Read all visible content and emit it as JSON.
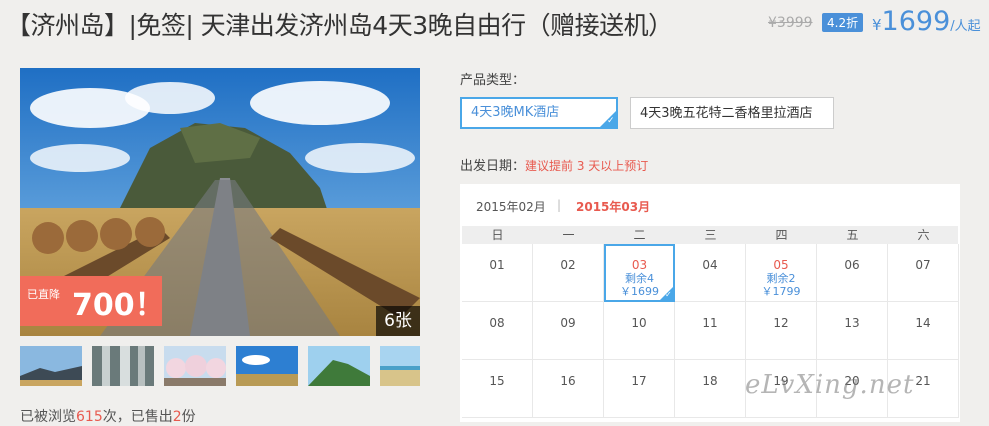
{
  "header": {
    "title": "【济州岛】|免签| 天津出发济州岛4天3晚自由行（赠接送机）",
    "original_price": "¥3999",
    "discount": "4.2折",
    "price_currency": "¥",
    "price_value": "1699",
    "price_unit": "/人起"
  },
  "gallery": {
    "drop_label": "已直降",
    "drop_amount": "700！",
    "photo_count": "6张",
    "thumbnails": [
      "coast-mountain",
      "waterfall-cliff",
      "cherry-blossom-road",
      "blue-sky-field",
      "green-crater",
      "beach"
    ]
  },
  "stats": {
    "prefix": "已被浏览",
    "views": "615",
    "middle": "次，已售出",
    "sold": "2",
    "suffix": "份"
  },
  "product": {
    "label": "产品类型：",
    "options": [
      "4天3晚MK酒店",
      "4天3晚五花特二香格里拉酒店"
    ],
    "selected_index": 0
  },
  "departure": {
    "label": "出发日期：",
    "note": "建议提前 3 天以上预订"
  },
  "calendar": {
    "prev_month": "2015年02月",
    "separator": "|",
    "current_month": "2015年03月",
    "weekdays": [
      "日",
      "一",
      "二",
      "三",
      "四",
      "五",
      "六"
    ],
    "rows": [
      [
        {
          "day": "01"
        },
        {
          "day": "02"
        },
        {
          "day": "03",
          "stock": "剩余4",
          "price": "￥1699",
          "selected": true
        },
        {
          "day": "04"
        },
        {
          "day": "05",
          "stock": "剩余2",
          "price": "￥1799"
        },
        {
          "day": "06"
        },
        {
          "day": "07"
        }
      ],
      [
        {
          "day": "08"
        },
        {
          "day": "09"
        },
        {
          "day": "10"
        },
        {
          "day": "11"
        },
        {
          "day": "12"
        },
        {
          "day": "13"
        },
        {
          "day": "14"
        }
      ],
      [
        {
          "day": "15"
        },
        {
          "day": "16"
        },
        {
          "day": "17"
        },
        {
          "day": "18"
        },
        {
          "day": "19"
        },
        {
          "day": "20"
        },
        {
          "day": "21"
        }
      ]
    ]
  },
  "watermark": "eLvXing.net",
  "colors": {
    "accent_blue": "#4a90d9",
    "highlight_red": "#e85a4f",
    "drop_badge": "#f16c5a"
  }
}
